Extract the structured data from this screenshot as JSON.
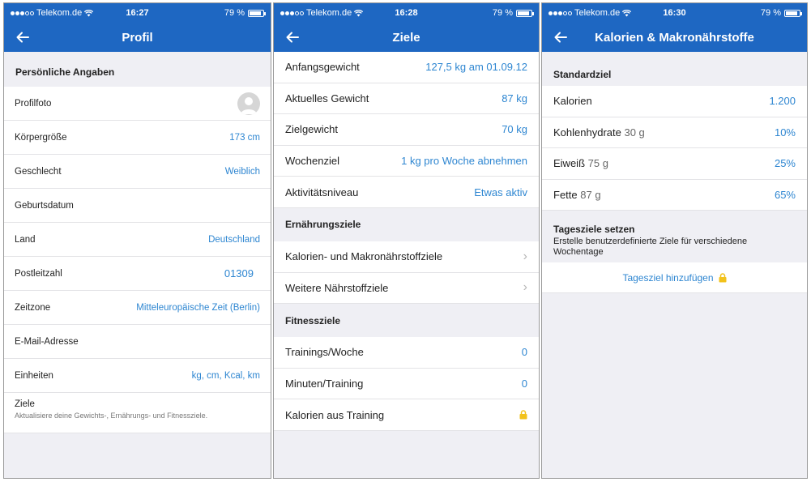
{
  "status": {
    "carrier": "Telekom.de",
    "battery": "79 %",
    "battery_level": 0.79
  },
  "screen1": {
    "time": "16:27",
    "title": "Profil",
    "section": "Persönliche Angaben",
    "rows": [
      {
        "label": "Profilfoto",
        "value": ""
      },
      {
        "label": "Körpergröße",
        "value": "173 cm"
      },
      {
        "label": "Geschlecht",
        "value": "Weiblich"
      },
      {
        "label": "Geburtsdatum",
        "value": ""
      },
      {
        "label": "Land",
        "value": "Deutschland"
      },
      {
        "label": "Postleitzahl",
        "value": "01309"
      },
      {
        "label": "Zeitzone",
        "value": "Mitteleuropäische Zeit (Berlin)"
      },
      {
        "label": "E-Mail-Adresse",
        "value": ""
      },
      {
        "label": "Einheiten",
        "value": "kg, cm, Kcal, km"
      }
    ],
    "ziele_label": "Ziele",
    "ziele_sub": "Aktualisiere deine Gewichts-, Ernährungs- und Fitnessziele."
  },
  "screen2": {
    "time": "16:28",
    "title": "Ziele",
    "weight_rows": [
      {
        "label": "Anfangsgewicht",
        "value": "127,5 kg am 01.09.12"
      },
      {
        "label": "Aktuelles Gewicht",
        "value": "87 kg"
      },
      {
        "label": "Zielgewicht",
        "value": "70 kg"
      },
      {
        "label": "Wochenziel",
        "value": "1 kg pro Woche abnehmen"
      },
      {
        "label": "Aktivitätsniveau",
        "value": "Etwas aktiv"
      }
    ],
    "nutrition_header": "Ernährungsziele",
    "nutrition_rows": [
      {
        "label": "Kalorien- und Makronährstoffziele"
      },
      {
        "label": "Weitere Nährstoffziele"
      }
    ],
    "fitness_header": "Fitnessziele",
    "fitness_rows": [
      {
        "label": "Trainings/Woche",
        "value": "0"
      },
      {
        "label": "Minuten/Training",
        "value": "0"
      },
      {
        "label": "Kalorien aus Training",
        "value": ""
      }
    ]
  },
  "screen3": {
    "time": "16:30",
    "title": "Kalorien & Makronährstoffe",
    "section": "Standardziel",
    "rows": [
      {
        "label": "Kalorien",
        "sub": "",
        "value": "1.200"
      },
      {
        "label": "Kohlenhydrate",
        "sub": "30 g",
        "value": "10%"
      },
      {
        "label": "Eiweiß",
        "sub": "75 g",
        "value": "25%"
      },
      {
        "label": "Fette",
        "sub": "87 g",
        "value": "65%"
      }
    ],
    "daily_title": "Tagesziele setzen",
    "daily_desc": "Erstelle benutzerdefinierte Ziele für verschiedene Wochentage",
    "add_label": "Tagesziel hinzufügen"
  },
  "colors": {
    "brand": "#1e67c2",
    "accent": "#2e86d1",
    "lock": "#f2c21b"
  }
}
